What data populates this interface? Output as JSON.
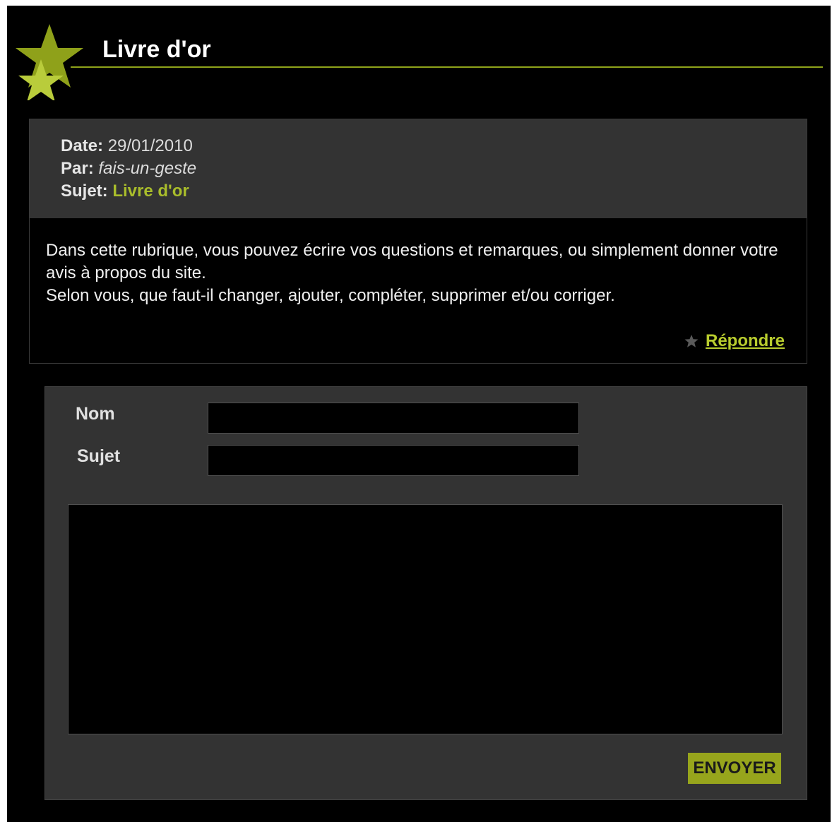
{
  "header": {
    "title": "Livre d'or",
    "logo_icon": "star-cluster-icon"
  },
  "post": {
    "date_label": "Date:",
    "date_value": "29/01/2010",
    "author_label": "Par:",
    "author_value": "fais-un-geste",
    "subject_label": "Sujet:",
    "subject_value": "Livre d'or",
    "body_line_1": "Dans cette rubrique, vous pouvez écrire vos questions et remarques, ou simplement donner votre avis à propos du site.",
    "body_line_2": "Selon vous, que faut-il changer, ajouter, compléter, supprimer et/ou corriger.",
    "reply_label": "Répondre",
    "reply_icon": "star-icon"
  },
  "form": {
    "name_label": "Nom",
    "name_value": "",
    "subject_label": "Sujet",
    "subject_value": "",
    "message_value": "",
    "submit_label": "ENVOYER"
  },
  "colors": {
    "accent": "#a9bd2b",
    "button": "#97a51c",
    "panel": "#333333",
    "background": "#000000"
  }
}
